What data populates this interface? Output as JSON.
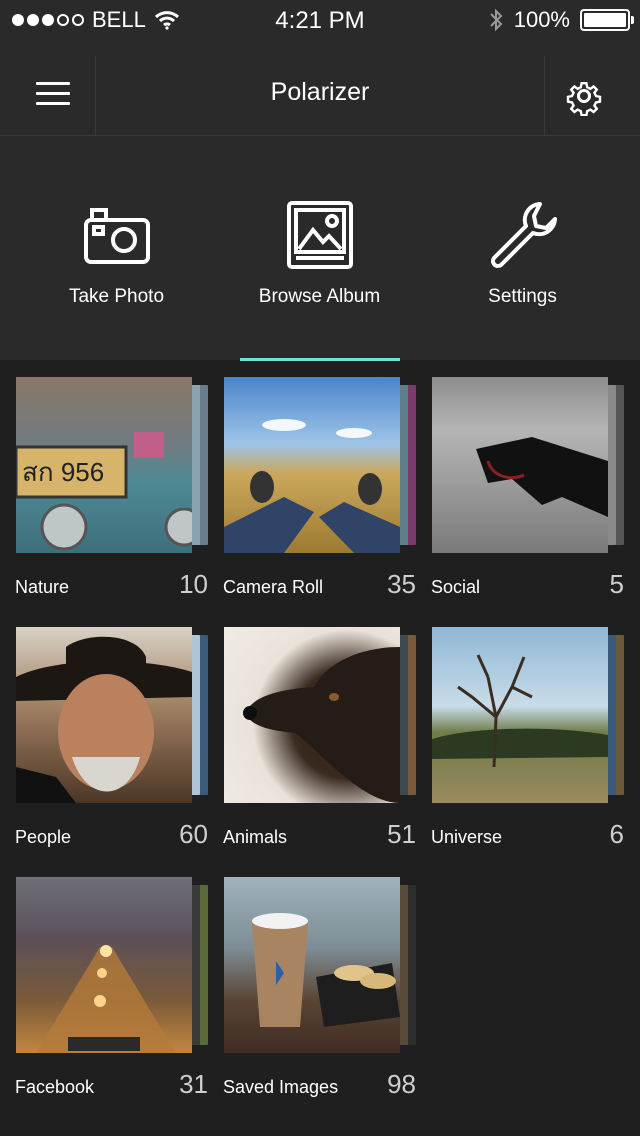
{
  "status_bar": {
    "carrier": "BELL",
    "time": "4:21 PM",
    "battery": "100%"
  },
  "nav": {
    "title": "Polarizer",
    "menu_icon": "hamburger-icon",
    "settings_icon": "gear-icon"
  },
  "actions": [
    {
      "label": "Take Photo",
      "icon": "camera-icon"
    },
    {
      "label": "Browse Album",
      "icon": "image-icon"
    },
    {
      "label": "Settings",
      "icon": "wrench-icon"
    }
  ],
  "active_tab": "Browse Album",
  "accent_color": "#6ee3d6",
  "albums": [
    {
      "name": "Nature",
      "count": "10"
    },
    {
      "name": "Camera Roll",
      "count": "35"
    },
    {
      "name": "Social",
      "count": "5"
    },
    {
      "name": "People",
      "count": "60"
    },
    {
      "name": "Animals",
      "count": "51"
    },
    {
      "name": "Universe",
      "count": "6"
    },
    {
      "name": "Facebook",
      "count": "31"
    },
    {
      "name": "Saved Images",
      "count": "98"
    }
  ]
}
